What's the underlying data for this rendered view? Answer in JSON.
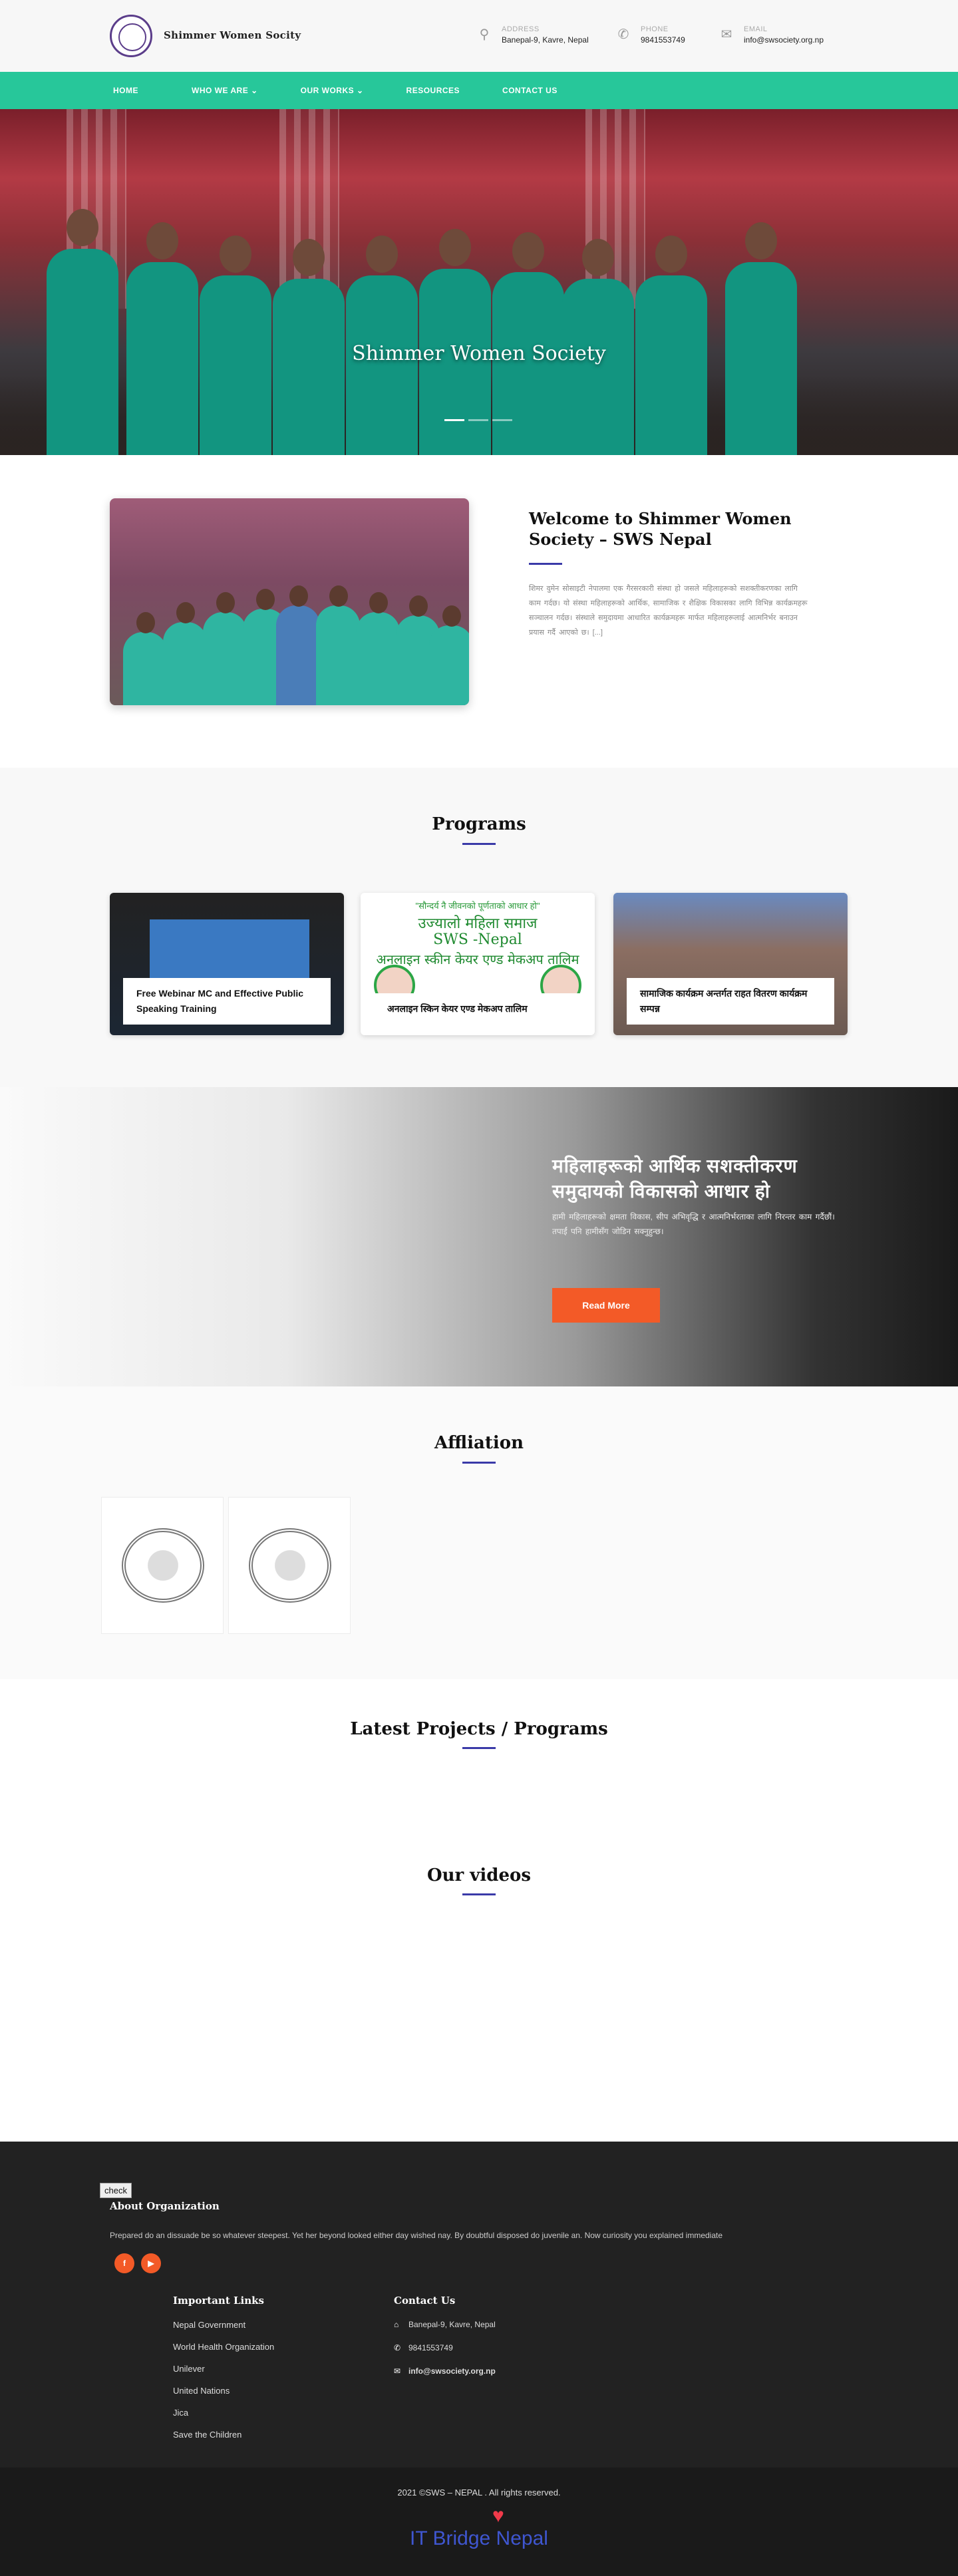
{
  "header": {
    "site_name": "Shimmer Women Socity",
    "address": {
      "label": "ADDRESS",
      "value": "Banepal-9, Kavre, Nepal"
    },
    "phone": {
      "label": "PHONE",
      "value": "9841553749"
    },
    "email": {
      "label": "EMAIL",
      "value": "info@swsociety.org.np"
    }
  },
  "nav": {
    "items": [
      "HOME",
      "WHO WE ARE",
      "OUR WORKS",
      "RESOURCES",
      "CONTACT US"
    ]
  },
  "hero": {
    "title": "Shimmer Women Society"
  },
  "welcome": {
    "title": "Welcome to Shimmer Women Society – SWS Nepal",
    "text": "शिमर वुमेन सोसाइटी नेपालमा एक गैरसरकारी संस्था हो जसले महिलाहरूको सशक्तीकरणका लागि काम गर्दछ। यो संस्था महिलाहरूको आर्थिक, सामाजिक र शैक्षिक विकासका लागि विभिन्न कार्यक्रमहरू सञ्चालन गर्दछ। संस्थाले समुदायमा आधारित कार्यक्रमहरू मार्फत महिलाहरूलाई आत्मनिर्भर बनाउन प्रयास गर्दै आएको छ। [...]"
  },
  "programs": {
    "title": "Programs",
    "cards": [
      {
        "caption": "Free Webinar MC and Effective Public Speaking Training"
      },
      {
        "caption": "अनलाइन स्किन केयर एण्ड मेकअप तालिम",
        "banner_line1": "\"सौन्दर्य नै जीवनको पूर्णताको आधार हो\"",
        "banner_line2": "उज्यालो महिला समाज",
        "banner_line3": "SWS -Nepal",
        "banner_line4": "अनलाइन स्कीन केयर एण्ड मेकअप तालिम"
      },
      {
        "caption": "सामाजिक कार्यक्रम अन्तर्गत राहत वितरण कार्यक्रम सम्पन्न"
      }
    ]
  },
  "cta": {
    "heading": "महिलाहरूको आर्थिक सशक्तीकरण समुदायको विकासको आधार हो",
    "text": "हामी महिलाहरूको क्षमता विकास, सीप अभिवृद्धि र आत्मनिर्भरताका लागि निरन्तर काम गर्दैछौं। तपाईं पनि हामीसँग जोडिन सक्नुहुन्छ।",
    "button": "Read More"
  },
  "affiliation": {
    "title": "Affliation",
    "logos": [
      "nepal-government-emblem-icon",
      "who-emblem-icon"
    ]
  },
  "latest": {
    "title": "Latest Projects / Programs"
  },
  "videos": {
    "title": "Our videos"
  },
  "footer": {
    "check": "check",
    "about_title": "About Organization",
    "about_text": "Prepared do an dissuade be so whatever steepest. Yet her beyond looked either day wished nay. By doubtful disposed do juvenile an. Now curiosity you explained immediate",
    "social": [
      "f",
      "▶"
    ],
    "links_title": "Important Links",
    "links": [
      "Nepal Government",
      "World Health Organization",
      "Unilever",
      "United Nations",
      "Jica",
      "Save the Children"
    ],
    "contact_title": "Contact Us",
    "contact": [
      "Banepal-9, Kavre, Nepal",
      "9841553749",
      "info@swsociety.org.np"
    ]
  },
  "bottom": {
    "copyright": "2021 ©SWS – NEPAL . All rights reserved.",
    "heart": "♥",
    "brand": "IT Bridge Nepal"
  }
}
